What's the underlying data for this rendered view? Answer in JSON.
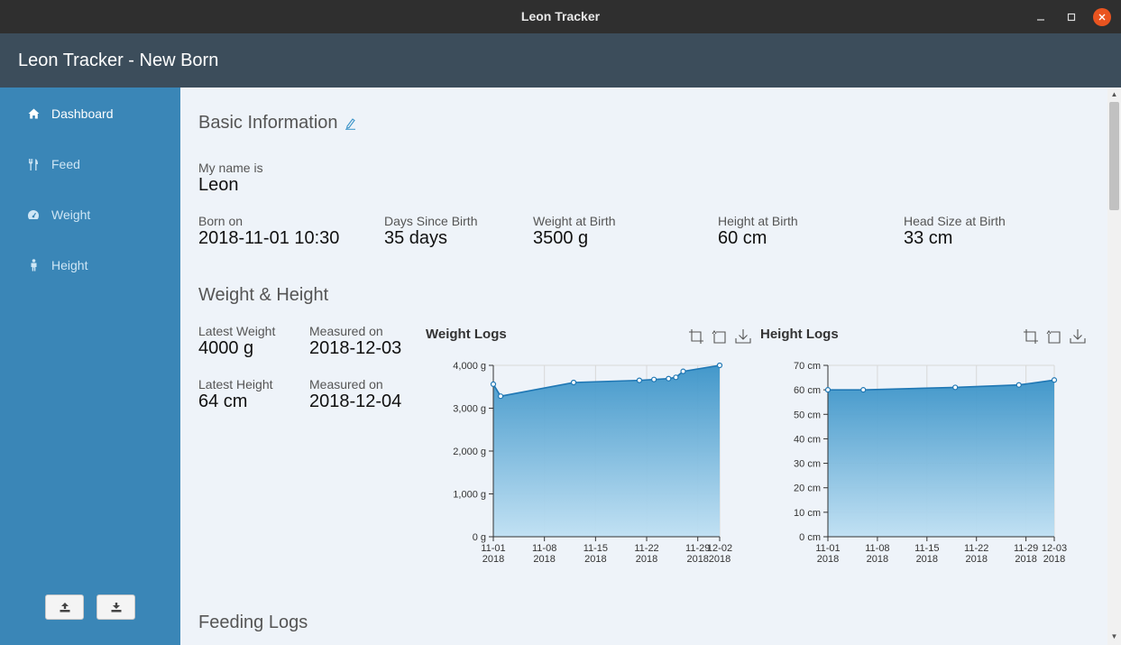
{
  "window": {
    "title": "Leon Tracker"
  },
  "app": {
    "title": "Leon Tracker - New Born"
  },
  "sidebar": {
    "items": [
      {
        "label": "Dashboard",
        "icon": "home-icon",
        "active": true
      },
      {
        "label": "Feed",
        "icon": "utensils-icon",
        "active": false
      },
      {
        "label": "Weight",
        "icon": "gauge-icon",
        "active": false
      },
      {
        "label": "Height",
        "icon": "person-icon",
        "active": false
      }
    ],
    "upload_icon": "upload-icon",
    "download_icon": "download-icon"
  },
  "basic": {
    "title": "Basic Information",
    "name_label": "My name is",
    "name": "Leon",
    "born_label": "Born on",
    "born": "2018-11-01 10:30",
    "days_label": "Days Since Birth",
    "days": "35 days",
    "weight_label": "Weight at Birth",
    "weight": "3500 g",
    "height_label": "Height at Birth",
    "height": "60 cm",
    "head_label": "Head Size at Birth",
    "head": "33 cm"
  },
  "wh": {
    "title": "Weight & Height",
    "latest_weight_label": "Latest Weight",
    "latest_weight": "4000 g",
    "weight_measured_label": "Measured on",
    "weight_measured": "2018-12-03",
    "latest_height_label": "Latest Height",
    "latest_height": "64 cm",
    "height_measured_label": "Measured on",
    "height_measured": "2018-12-04"
  },
  "feeding": {
    "title": "Feeding Logs"
  },
  "colors": {
    "accent": "#3a86b7",
    "series": "#1f77b4",
    "area_top": "#3a93c8",
    "area_bottom": "#bfe0f3"
  },
  "chart_data": [
    {
      "type": "area",
      "title": "Weight Logs",
      "xlabel": "",
      "ylabel": "",
      "x_ticks": [
        "11-01 2018",
        "11-08 2018",
        "11-15 2018",
        "11-22 2018",
        "11-29 2018",
        "12-02 2018"
      ],
      "y_ticks": [
        "0 g",
        "1,000 g",
        "2,000 g",
        "3,000 g",
        "4,000 g"
      ],
      "ylim": [
        0,
        4000
      ],
      "xlim": [
        "2018-11-01",
        "2018-12-02"
      ],
      "grid": true,
      "x": [
        "2018-11-01",
        "2018-11-02",
        "2018-11-12",
        "2018-11-21",
        "2018-11-23",
        "2018-11-25",
        "2018-11-26",
        "2018-11-27",
        "2018-12-02"
      ],
      "y": [
        3560,
        3280,
        3600,
        3650,
        3670,
        3690,
        3720,
        3860,
        4000
      ]
    },
    {
      "type": "area",
      "title": "Height Logs",
      "xlabel": "",
      "ylabel": "",
      "x_ticks": [
        "11-01 2018",
        "11-08 2018",
        "11-15 2018",
        "11-22 2018",
        "11-29 2018",
        "12-03 2018"
      ],
      "y_ticks": [
        "0 cm",
        "10 cm",
        "20 cm",
        "30 cm",
        "40 cm",
        "50 cm",
        "60 cm",
        "70 cm"
      ],
      "ylim": [
        0,
        70
      ],
      "xlim": [
        "2018-11-01",
        "2018-12-03"
      ],
      "grid": true,
      "x": [
        "2018-11-01",
        "2018-11-06",
        "2018-11-19",
        "2018-11-28",
        "2018-12-03"
      ],
      "y": [
        60,
        60,
        61,
        62,
        64
      ]
    }
  ]
}
